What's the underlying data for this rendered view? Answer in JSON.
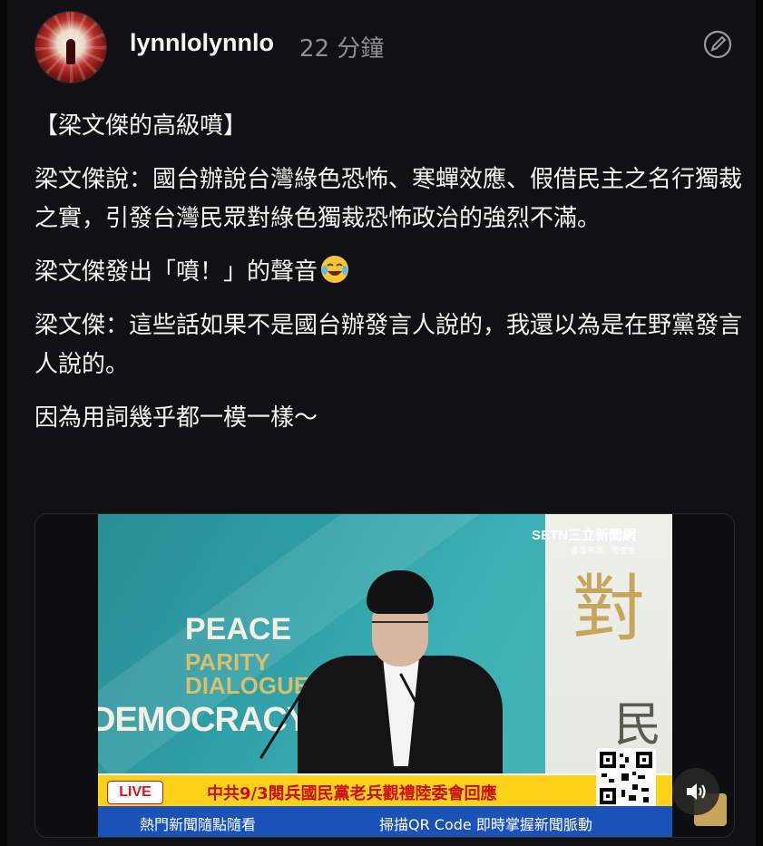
{
  "post": {
    "username": "lynnlolynnlo",
    "time_ago": "22 分鐘"
  },
  "content": {
    "title": "【梁文傑的高級噴】",
    "paragraph_1": "梁文傑說：國台辦說台灣綠色恐怖、寒蟬效應、假借民主之名行獨裁之實，引發台灣民眾對綠色獨裁恐怖政治的強烈不滿。",
    "paragraph_2": "梁文傑發出「噴！」的聲音",
    "paragraph_2_emoji": "rolling-on-the-floor-laughing-emoji",
    "paragraph_3": "梁文傑：這些話如果不是國台辦發言人說的，我還以為是在野黨發言人說的。",
    "paragraph_4": "因為用詞幾乎都一模一樣～"
  },
  "video": {
    "channel": "SETN三立新聞網",
    "source_note": "畫面來源：陸委會",
    "backdrop": {
      "word_1": "PEACE",
      "word_2": "PARITY",
      "word_3": "DIALOGUE",
      "word_4": "DEMOCRACY",
      "calligraphy_1": "對",
      "calligraphy_2": "民"
    },
    "live_label": "LIVE",
    "headline": "中共9/3閱兵國民黨老兵觀禮陸委會回應",
    "ticker_left": "熱門新聞隨點隨看",
    "ticker_right": "掃描QR Code 即時掌握新聞脈動",
    "sound_button": "speaker-volume-icon"
  },
  "colors": {
    "background": "#111113",
    "accent_live": "#d4161b",
    "news_bar": "#ffd21a",
    "ticker_bar": "#1a52b8"
  }
}
